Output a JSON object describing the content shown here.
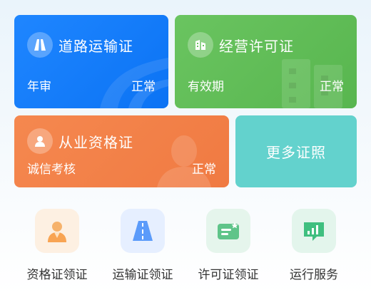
{
  "cards": {
    "road_transport": {
      "title": "道路运输证",
      "field_label": "年审",
      "status": "正常",
      "color": "#0b73f4"
    },
    "business_license": {
      "title": "经营许可证",
      "field_label": "有效期",
      "status": "正常",
      "color": "#58b64f"
    },
    "professional": {
      "title": "从业资格证",
      "field_label": "诚信考核",
      "status": "正常",
      "color": "#f07a42"
    },
    "more": {
      "label": "更多证照",
      "color": "#63d2cd"
    }
  },
  "services": [
    {
      "label": "资格证领证",
      "icon": "person-icon"
    },
    {
      "label": "运输证领证",
      "icon": "road-icon"
    },
    {
      "label": "许可证领证",
      "icon": "id-card-icon"
    },
    {
      "label": "运行服务",
      "icon": "chart-monitor-icon"
    }
  ]
}
